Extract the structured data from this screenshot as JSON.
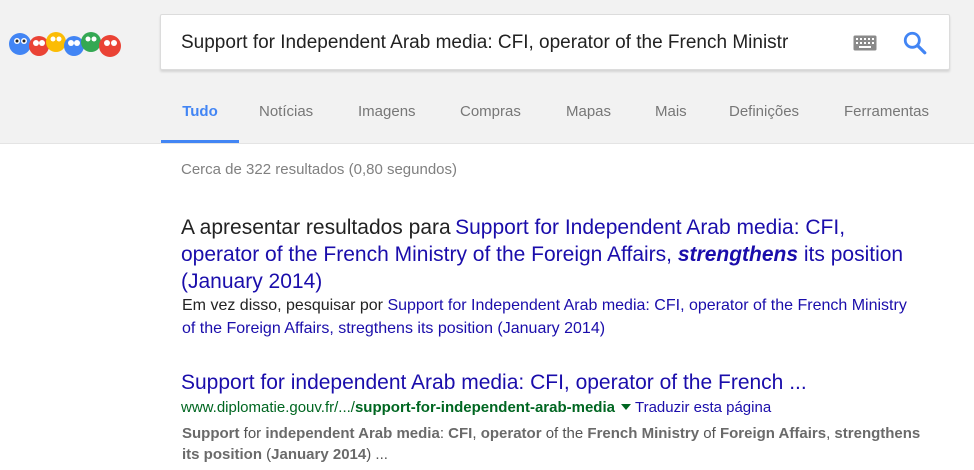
{
  "search": {
    "query": "Support for Independent Arab media: CFI, operator of the French Ministr"
  },
  "tabs": [
    {
      "label": "Tudo"
    },
    {
      "label": "Notícias"
    },
    {
      "label": "Imagens"
    },
    {
      "label": "Compras"
    },
    {
      "label": "Mapas"
    },
    {
      "label": "Mais"
    },
    {
      "label": "Definições"
    },
    {
      "label": "Ferramentas"
    }
  ],
  "stats": "Cerca de 322 resultados (0,80 segundos)",
  "spelling": {
    "prefix": "A apresentar resultados para",
    "corrected_pre": "Support for Independent Arab media: CFI, operator of the French Ministry of the Foreign Affairs,",
    "corrected_bold": "strengthens",
    "corrected_post": "its position (January 2014)",
    "instead_label": "Em vez disso, pesquisar por",
    "original": "Support for Independent Arab media: CFI, operator of the French Ministry of the Foreign Affairs, stregthens its position (January 2014)"
  },
  "result": {
    "title": "Support for independent Arab media: CFI, operator of the French ...",
    "url_prefix": "www.diplomatie.gouv.fr/.../",
    "url_bold": "support-for-independent-arab-media",
    "translate": "Traduzir esta página",
    "snippet": [
      {
        "b": "Support"
      },
      {
        "t": " for "
      },
      {
        "b": "independent Arab media"
      },
      {
        "t": ": "
      },
      {
        "b": "CFI"
      },
      {
        "t": ", "
      },
      {
        "b": "operator"
      },
      {
        "t": " of the "
      },
      {
        "b": "French Ministry"
      },
      {
        "t": " of "
      },
      {
        "b": "Foreign Affairs"
      },
      {
        "t": ", "
      },
      {
        "b": "strengthens its position"
      },
      {
        "t": " ("
      },
      {
        "b": "January 2014"
      },
      {
        "t": ") ..."
      }
    ]
  },
  "colors": {
    "link": "#1a0dab",
    "url": "#006621",
    "active_tab": "#4285f4",
    "header_bg": "#f2f2f2"
  },
  "icons": {
    "logo": "google-doodle-logo",
    "keyboard": "keyboard-icon",
    "search": "search-icon"
  }
}
